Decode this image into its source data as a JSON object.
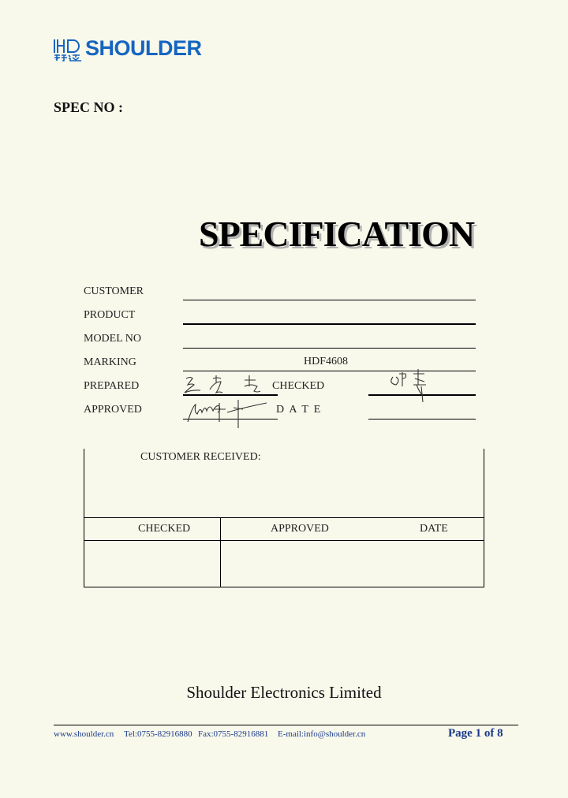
{
  "header": {
    "logo_mark_text": "HD",
    "logo_mark_sub": "好达",
    "logo_text": "SHOULDER",
    "brand_color": "#1565c0"
  },
  "spec_no_label": "SPEC NO :",
  "title": "SPECIFICATION",
  "form": {
    "customer_label": "CUSTOMER",
    "product_label": "PRODUCT",
    "model_no_label": "MODEL NO",
    "marking_label": "MARKING",
    "marking_value": "HDF4608",
    "prepared_label": "PREPARED",
    "checked_label": "CHECKED",
    "approved_label": "APPROVED",
    "date_label": "D  A  T  E"
  },
  "customer_box": {
    "received_label": "CUSTOMER RECEIVED:",
    "col_checked": "CHECKED",
    "col_approved": "APPROVED",
    "col_date": "DATE"
  },
  "company_name": "Shoulder Electronics Limited",
  "footer": {
    "website": "www.shoulder.cn",
    "tel": "Tel:0755-82916880",
    "fax": "Fax:0755-82916881",
    "email": "E-mail:info@shoulder.cn",
    "page": "Page 1 of 8",
    "footer_color": "#1a3a8a"
  }
}
